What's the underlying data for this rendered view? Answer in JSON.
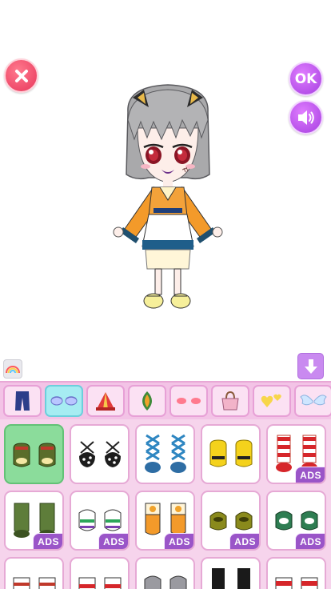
{
  "buttons": {
    "ok_label": "OK"
  },
  "tabs": [
    {
      "name": "pants",
      "selected": false
    },
    {
      "name": "eyes",
      "selected": true
    },
    {
      "name": "hat",
      "selected": false
    },
    {
      "name": "accessory",
      "selected": false
    },
    {
      "name": "blush",
      "selected": false
    },
    {
      "name": "bag",
      "selected": false
    },
    {
      "name": "hearts",
      "selected": false
    },
    {
      "name": "wings",
      "selected": false
    }
  ],
  "items": [
    {
      "icon": "green-shoes-icon",
      "ads": false,
      "selected": true
    },
    {
      "icon": "black-dotted-shoes-icon",
      "ads": false,
      "selected": false
    },
    {
      "icon": "blue-lace-boots-icon",
      "ads": false,
      "selected": false
    },
    {
      "icon": "yellow-flats-icon",
      "ads": false,
      "selected": false
    },
    {
      "icon": "red-striped-boots-icon",
      "ads": true,
      "selected": false
    },
    {
      "icon": "green-boots-icon",
      "ads": true,
      "selected": false
    },
    {
      "icon": "green-sneakers-icon",
      "ads": true,
      "selected": false
    },
    {
      "icon": "orange-flower-boots-icon",
      "ads": true,
      "selected": false
    },
    {
      "icon": "olive-shoes-icon",
      "ads": true,
      "selected": false
    },
    {
      "icon": "green-clogs-icon",
      "ads": true,
      "selected": false
    },
    {
      "icon": "red-sneakers-icon",
      "ads": false,
      "selected": false
    },
    {
      "icon": "red-white-shoes-icon",
      "ads": false,
      "selected": false
    },
    {
      "icon": "gray-shoes-icon",
      "ads": false,
      "selected": false
    },
    {
      "icon": "black-boots-icon",
      "ads": false,
      "selected": false
    },
    {
      "icon": "red-shoes-icon",
      "ads": false,
      "selected": false
    }
  ],
  "ads_label": "ADS",
  "colors": {
    "tab_bar": "#f3c3e6",
    "panel": "#f6d4ec",
    "selected_item": "#8bdc9b",
    "ads_badge": "#9a55c8"
  }
}
